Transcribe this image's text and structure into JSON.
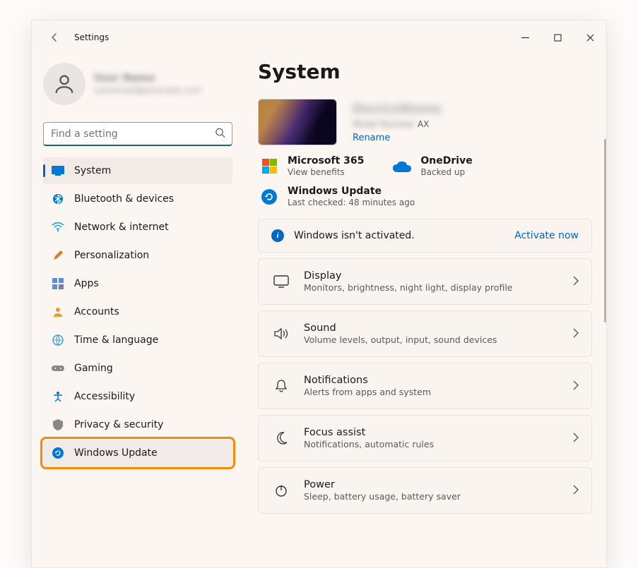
{
  "window": {
    "title": "Settings"
  },
  "profile": {
    "name": "User Name",
    "email": "useremail@example.com"
  },
  "search": {
    "placeholder": "Find a setting"
  },
  "sidebar": {
    "items": [
      {
        "label": "System"
      },
      {
        "label": "Bluetooth & devices"
      },
      {
        "label": "Network & internet"
      },
      {
        "label": "Personalization"
      },
      {
        "label": "Apps"
      },
      {
        "label": "Accounts"
      },
      {
        "label": "Time & language"
      },
      {
        "label": "Gaming"
      },
      {
        "label": "Accessibility"
      },
      {
        "label": "Privacy & security"
      },
      {
        "label": "Windows Update"
      }
    ]
  },
  "page": {
    "title": "System"
  },
  "device": {
    "name": "DeviceName",
    "model": "Model Number",
    "model_suffix": " AX",
    "rename": "Rename"
  },
  "cards": {
    "m365": {
      "title": "Microsoft 365",
      "sub": "View benefits"
    },
    "onedrive": {
      "title": "OneDrive",
      "sub": "Backed up"
    },
    "wu": {
      "title": "Windows Update",
      "sub": "Last checked: 48 minutes ago"
    }
  },
  "activation": {
    "text": "Windows isn't activated.",
    "link": "Activate now"
  },
  "settings": [
    {
      "title": "Display",
      "sub": "Monitors, brightness, night light, display profile"
    },
    {
      "title": "Sound",
      "sub": "Volume levels, output, input, sound devices"
    },
    {
      "title": "Notifications",
      "sub": "Alerts from apps and system"
    },
    {
      "title": "Focus assist",
      "sub": "Notifications, automatic rules"
    },
    {
      "title": "Power",
      "sub": "Sleep, battery usage, battery saver"
    }
  ]
}
